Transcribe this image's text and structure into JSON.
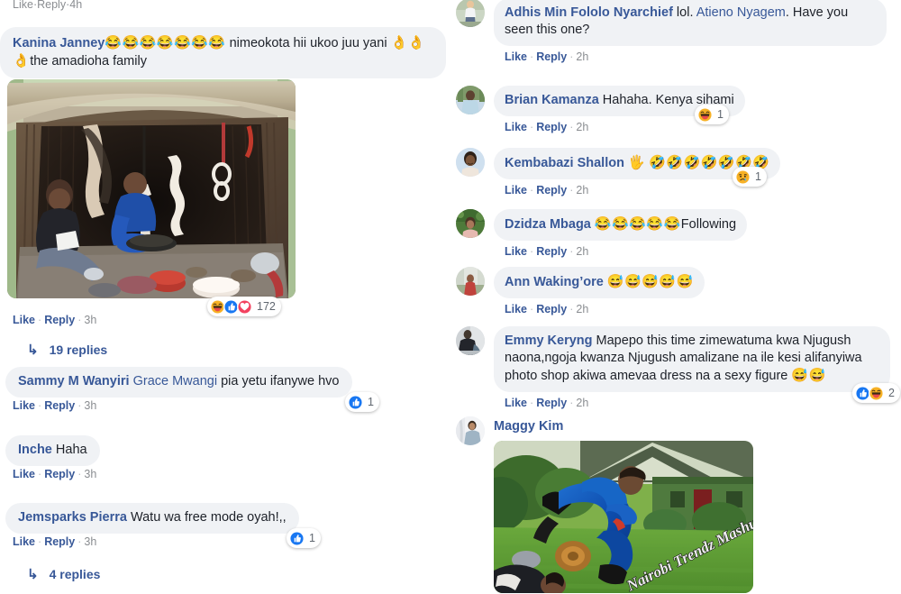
{
  "app": {
    "name": "facebook-comments-thread"
  },
  "actions": {
    "like": "Like",
    "reply": "Reply",
    "separator": "·"
  },
  "left_column": {
    "top_meta": {
      "like": "Like",
      "reply": "Reply",
      "time": "4h"
    },
    "comments": [
      {
        "id": "kanina-janney",
        "author": "Kanina Janney",
        "emoji_run_1": "😂😂😂😂😂😂😂",
        "text": " nimeokota hii ukoo juu yani ",
        "emoji_run_2": "👌👌👌",
        "text_2": "the amadioha family",
        "has_photo": true,
        "photo_alt": "group-of-people-inside-thatched-hut",
        "meta": {
          "like": "Like",
          "reply": "Reply",
          "time": "3h"
        },
        "reactions": {
          "types": [
            "haha",
            "like",
            "love"
          ],
          "count": "172"
        },
        "replies_link": "19 replies"
      },
      {
        "id": "sammy-m-wanyiri",
        "author": "Sammy M Wanyiri",
        "mention": "Grace Mwangi",
        "text": " pia yetu ifanywe hvo",
        "meta": {
          "like": "Like",
          "reply": "Reply",
          "time": "3h"
        },
        "reactions": {
          "types": [
            "like"
          ],
          "count": "1"
        }
      },
      {
        "id": "inche",
        "author": "Inche",
        "text": " Haha",
        "meta": {
          "like": "Like",
          "reply": "Reply",
          "time": "3h"
        }
      },
      {
        "id": "jemsparks-pierra",
        "author": "Jemsparks Pierra",
        "text": " Watu wa free mode oyah!,,",
        "meta": {
          "like": "Like",
          "reply": "Reply",
          "time": "3h"
        },
        "reactions": {
          "types": [
            "like"
          ],
          "count": "1"
        },
        "replies_link": "4 replies"
      }
    ]
  },
  "right_column": {
    "comments": [
      {
        "id": "adhis-min-fololo-nyarchief",
        "author": "Adhis Min Fololo Nyarchief",
        "text_pre": " lol. ",
        "mention": "Atieno Nyagem",
        "text": ". Have you seen this one?",
        "avatar_alt": "woman-standing-outdoors-avatar",
        "meta": {
          "like": "Like",
          "reply": "Reply",
          "time": "2h"
        }
      },
      {
        "id": "brian-kamanza",
        "author": "Brian Kamanza",
        "text": " Hahaha. Kenya sihami",
        "avatar_alt": "man-in-light-blue-shirt-avatar",
        "meta": {
          "like": "Like",
          "reply": "Reply",
          "time": "2h"
        },
        "reactions": {
          "types": [
            "haha"
          ],
          "count": "1"
        }
      },
      {
        "id": "kembabazi-shallon",
        "author": "Kembabazi Shallon",
        "emoji_run_1": "🖐",
        "emoji_run_2": "🤣🤣🤣🤣🤣🤣🤣",
        "avatar_alt": "smiling-woman-avatar",
        "meta": {
          "like": "Like",
          "reply": "Reply",
          "time": "2h"
        },
        "reactions": {
          "types": [
            "sad"
          ],
          "count": "1"
        }
      },
      {
        "id": "dzidza-mbaga",
        "author": "Dzidza Mbaga",
        "emoji_run_1": "😂😂😂😂😂",
        "text": "Following",
        "avatar_alt": "woman-in-greenery-avatar",
        "meta": {
          "like": "Like",
          "reply": "Reply",
          "time": "2h"
        }
      },
      {
        "id": "ann-wakingore",
        "author": "Ann Waking’ore",
        "emoji_run_1": "😅😅😅😅😅",
        "avatar_alt": "person-outdoors-avatar",
        "meta": {
          "like": "Like",
          "reply": "Reply",
          "time": "2h"
        }
      },
      {
        "id": "emmy-keryng",
        "author": "Emmy Keryng",
        "text": " Mapepo this time zimewatuma kwa Njugush naona,ngoja kwanza Njugush amalizane na ile kesi alifanyiwa photo shop akiwa amevaa dress na a sexy figure ",
        "emoji_run_1": "😅😅",
        "avatar_alt": "person-in-dark-jacket-avatar",
        "meta": {
          "like": "Like",
          "reply": "Reply",
          "time": "2h"
        },
        "reactions": {
          "types": [
            "like",
            "haha"
          ],
          "count": "2"
        }
      },
      {
        "id": "maggy-kim",
        "author": "Maggy Kim",
        "avatar_alt": "person-in-grey-shirt-avatar",
        "has_photo": true,
        "photo_alt": "man-in-blue-suit-flying-kick-meme-with-watermark",
        "photo_watermark": "Nairobi Trendz Mashup"
      }
    ]
  },
  "colors": {
    "bubble_bg": "#f0f2f5",
    "author_link": "#385898",
    "body_text": "#1d2129",
    "meta_text": "#8a8d91",
    "like_blue": "#1877f2",
    "love_red": "#f3425f",
    "haha_yellow": "#f7b125"
  }
}
